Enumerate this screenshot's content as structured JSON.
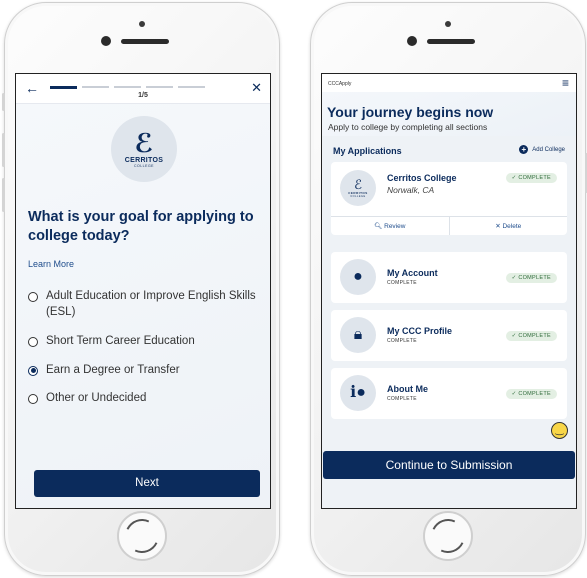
{
  "left_screen": {
    "progress": {
      "total_segments": 5,
      "active_segment": 1,
      "label": "1/5"
    },
    "logo": {
      "name": "CERRITOS",
      "subtitle": "COLLEGE"
    },
    "question": "What is your goal for applying to college today?",
    "learn_more": "Learn More",
    "options": [
      {
        "label": "Adult Education or Improve English Skills (ESL)",
        "selected": false
      },
      {
        "label": "Short Term Career Education",
        "selected": false
      },
      {
        "label": "Earn a Degree or Transfer",
        "selected": true
      },
      {
        "label": "Other or Undecided",
        "selected": false
      }
    ],
    "next_button": "Next",
    "icons": {
      "back": "arrow-left-icon",
      "close": "close-icon",
      "feedback": "smiley-face-icon"
    }
  },
  "right_screen": {
    "app_name": "CCCApply",
    "title": "Your journey begins now",
    "subtitle": "Apply to college by completing all sections",
    "section_title": "My Applications",
    "add_college": "Add College",
    "college_card": {
      "name": "Cerritos College",
      "location": "Norwalk, CA",
      "status": "✓ COMPLETE",
      "review": "Review",
      "delete": "Delete",
      "logo_name": "CERRITOS",
      "logo_subtitle": "COLLEGE"
    },
    "cards": [
      {
        "title": "My Account",
        "sub": "COMPLETE",
        "status": "✓ COMPLETE",
        "icon": "person-icon"
      },
      {
        "title": "My CCC Profile",
        "sub": "COMPLETE",
        "status": "✓ COMPLETE",
        "icon": "lock-icon"
      },
      {
        "title": "About Me",
        "sub": "COMPLETE",
        "status": "✓ COMPLETE",
        "icon": "person-info-icon"
      }
    ],
    "continue_button": "Continue to Submission"
  },
  "colors": {
    "brand_navy": "#0b2b5c",
    "complete_badge_bg": "#e3efe3",
    "complete_badge_text": "#2f6b3a"
  }
}
